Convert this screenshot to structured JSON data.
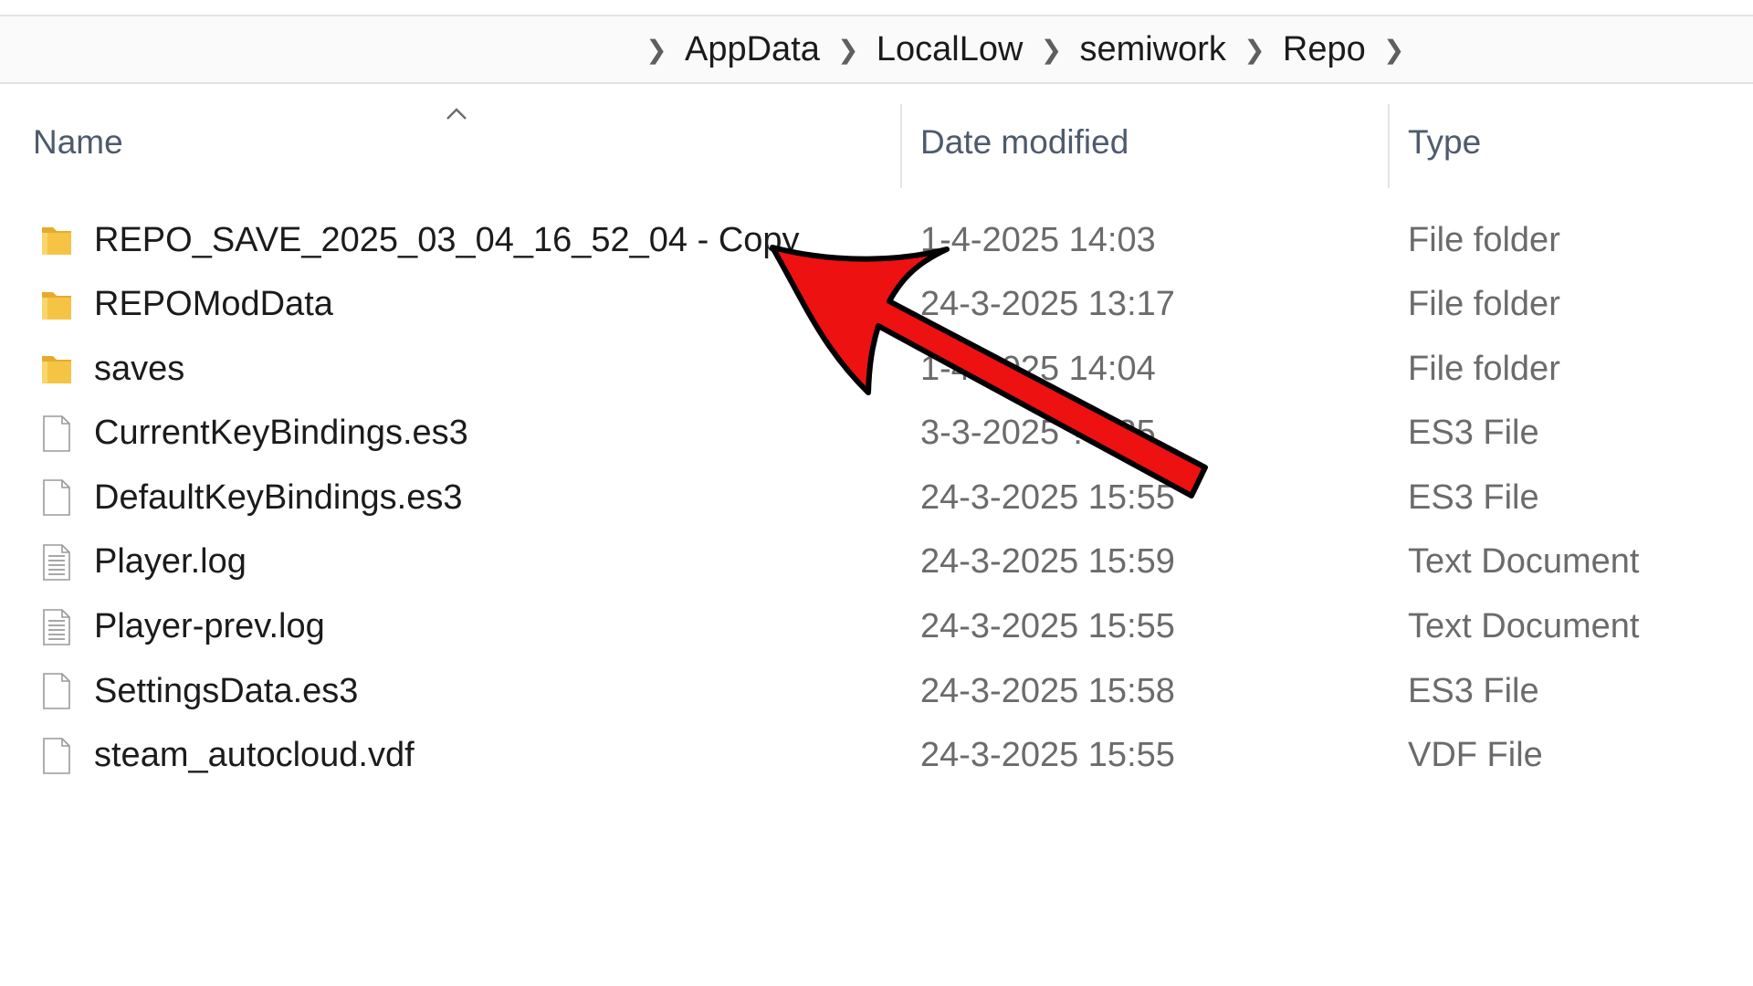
{
  "breadcrumb": {
    "items": [
      "AppData",
      "LocalLow",
      "semiwork",
      "Repo"
    ]
  },
  "columns": {
    "name": "Name",
    "date_modified": "Date modified",
    "type": "Type"
  },
  "sort": {
    "column": "Name",
    "direction": "ascending"
  },
  "files": [
    {
      "name": "REPO_SAVE_2025_03_04_16_52_04 - Copy",
      "date": "1-4-2025 14:03",
      "type": "File folder",
      "icon": "folder-icon"
    },
    {
      "name": "REPOModData",
      "date": "24-3-2025 13:17",
      "type": "File folder",
      "icon": "folder-icon"
    },
    {
      "name": "saves",
      "date": "1-4-2025 14:04",
      "type": "File folder",
      "icon": "folder-icon"
    },
    {
      "name": "CurrentKeyBindings.es3",
      "date": "3-3-2025 ??:35",
      "type": "ES3 File",
      "icon": "file-icon"
    },
    {
      "name": "DefaultKeyBindings.es3",
      "date": "24-3-2025 15:55",
      "type": "ES3 File",
      "icon": "file-icon"
    },
    {
      "name": "Player.log",
      "date": "24-3-2025 15:59",
      "type": "Text Document",
      "icon": "text-file-icon"
    },
    {
      "name": "Player-prev.log",
      "date": "24-3-2025 15:55",
      "type": "Text Document",
      "icon": "text-file-icon"
    },
    {
      "name": "SettingsData.es3",
      "date": "24-3-2025 15:58",
      "type": "ES3 File",
      "icon": "file-icon"
    },
    {
      "name": "steam_autocloud.vdf",
      "date": "24-3-2025 15:55",
      "type": "VDF File",
      "icon": "file-icon"
    }
  ],
  "annotation": {
    "icon": "red-arrow-icon",
    "color": "#ee1111",
    "outline": "#000000"
  },
  "colors": {
    "folder": "#f5c445",
    "header_text": "#4e5a6e",
    "secondary_text": "#6b6b6b"
  }
}
